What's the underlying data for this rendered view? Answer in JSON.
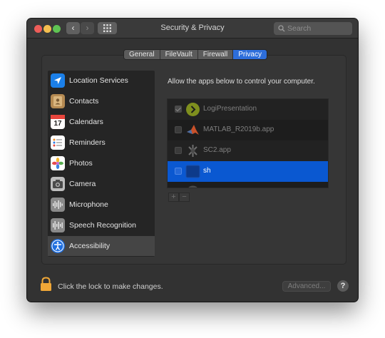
{
  "window": {
    "title": "Security & Privacy",
    "search_placeholder": "Search"
  },
  "tabs": [
    {
      "label": "General",
      "active": false
    },
    {
      "label": "FileVault",
      "active": false
    },
    {
      "label": "Firewall",
      "active": false
    },
    {
      "label": "Privacy",
      "active": true
    }
  ],
  "sidebar": {
    "items": [
      {
        "label": "Location Services",
        "icon": "location-arrow-icon"
      },
      {
        "label": "Contacts",
        "icon": "contacts-book-icon"
      },
      {
        "label": "Calendars",
        "icon": "calendar-icon",
        "calendar_day": "17"
      },
      {
        "label": "Reminders",
        "icon": "reminders-list-icon"
      },
      {
        "label": "Photos",
        "icon": "photos-flower-icon"
      },
      {
        "label": "Camera",
        "icon": "camera-icon"
      },
      {
        "label": "Microphone",
        "icon": "microphone-waveform-icon"
      },
      {
        "label": "Speech Recognition",
        "icon": "speech-waveform-icon"
      },
      {
        "label": "Accessibility",
        "icon": "accessibility-icon",
        "selected": true
      }
    ]
  },
  "main": {
    "description": "Allow the apps below to control your computer.",
    "apps": [
      {
        "name": "LogiPresentation",
        "checked": true,
        "icon": "logi-presentation-icon"
      },
      {
        "name": "MATLAB_R2019b.app",
        "checked": false,
        "icon": "matlab-icon"
      },
      {
        "name": "SC2.app",
        "checked": false,
        "icon": "sc2-app-icon"
      },
      {
        "name": "sh",
        "checked": false,
        "icon": "shell-app-icon",
        "selected": true
      }
    ],
    "add_label": "+",
    "remove_label": "−"
  },
  "footer": {
    "lock_text": "Click the lock to make changes.",
    "advanced_label": "Advanced...",
    "help_label": "?"
  },
  "colors": {
    "accent": "#2d6edb",
    "selection": "#0a58d1",
    "lock": "#f0a737"
  }
}
